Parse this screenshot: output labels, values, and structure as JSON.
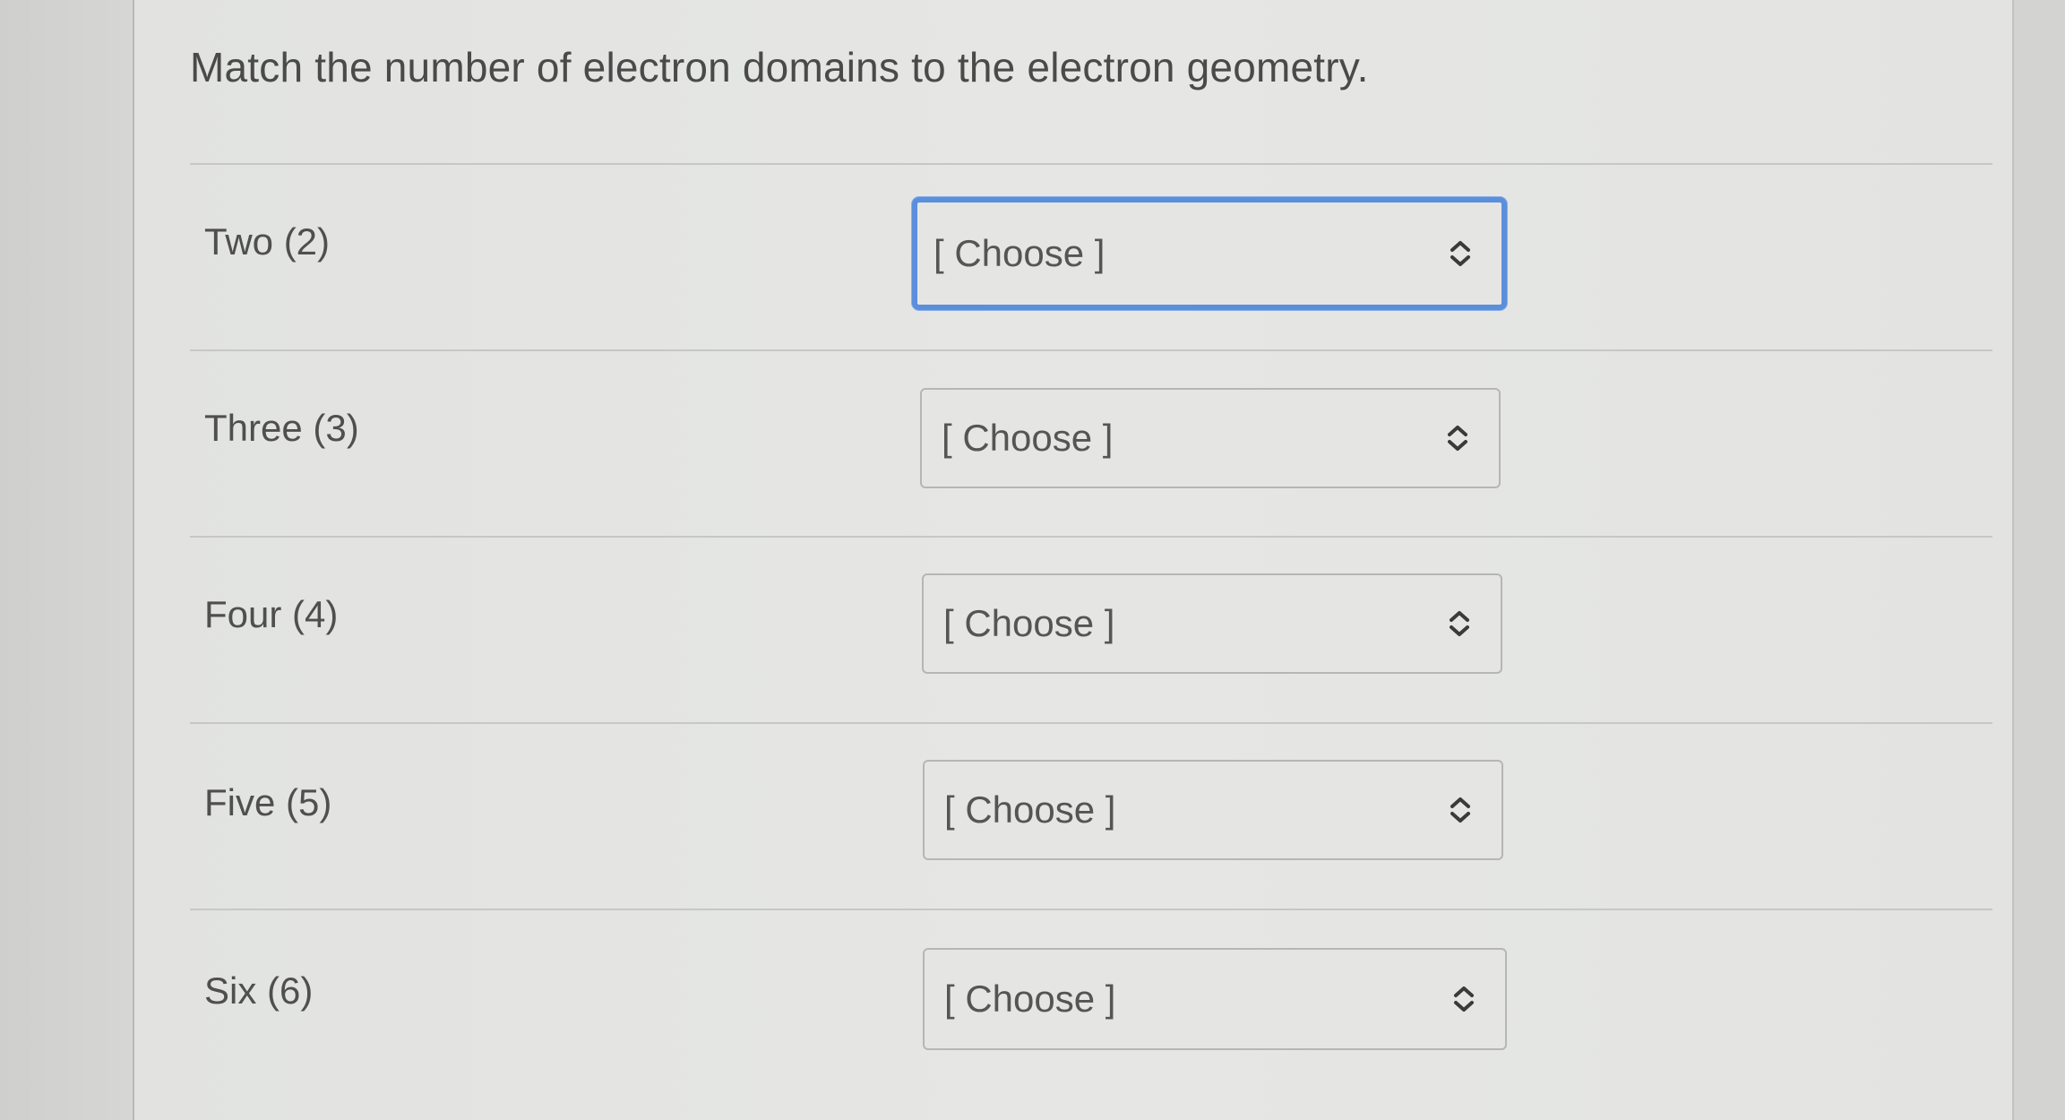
{
  "question": {
    "title": "Match the number of electron domains to the electron geometry."
  },
  "rows": [
    {
      "label": "Two (2)",
      "select_value": "[ Choose ]",
      "focused": true
    },
    {
      "label": "Three (3)",
      "select_value": "[ Choose ]",
      "focused": false
    },
    {
      "label": "Four (4)",
      "select_value": "[ Choose ]",
      "focused": false
    },
    {
      "label": "Five (5)",
      "select_value": "[ Choose ]",
      "focused": false
    },
    {
      "label": "Six (6)",
      "select_value": "[ Choose ]",
      "focused": false
    }
  ],
  "icons": {
    "select_arrow": "chevron-up-down-icon"
  },
  "colors": {
    "focus_border": "#5b8fdc",
    "text": "#4a4a4a"
  }
}
